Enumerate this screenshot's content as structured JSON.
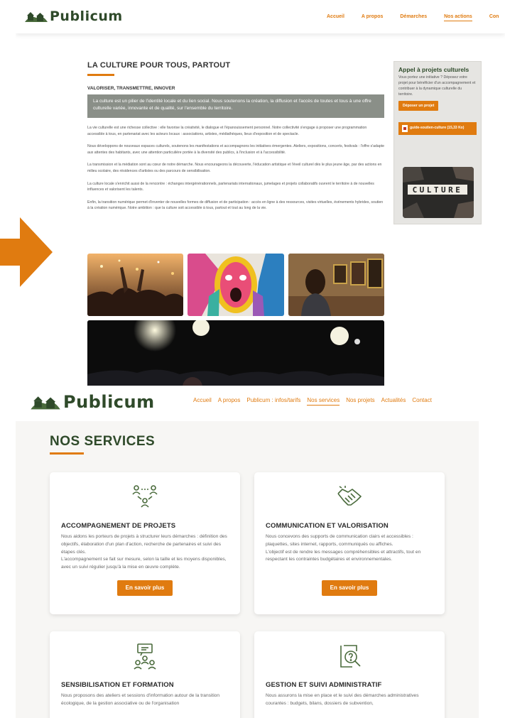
{
  "top_screenshot": {
    "brand": "Publicum",
    "nav": [
      "Accueil",
      "A propos",
      "Démarches",
      "Nos actions",
      "Con"
    ],
    "active_nav_index": 3,
    "page_title": "LA CULTURE POUR TOUS, PARTOUT",
    "subtitle": "VALORISER, TRANSMETTRE, INNOVER",
    "intro": "La culture est un pilier de l'identité locale et du lien social. Nous soutenons la création, la diffusion et l'accès de toutes et tous à une offre culturelle variée, innovante et de qualité, sur l'ensemble du territoire.",
    "paragraphs": [
      "La vie culturelle est une richesse collective : elle favorise la créativité, le dialogue et l'épanouissement personnel. Notre collectivité s'engage à proposer une programmation accessible à tous, en partenariat avec les acteurs locaux : associations, artistes, médiathèques, lieux d'exposition et de spectacle.",
      "Nous développons de nouveaux espaces culturels, soutenons les manifestations et accompagnons les initiatives émergentes. Ateliers, expositions, concerts, festivals : l'offre s'adapte aux attentes des habitants, avec une attention particulière portée à la diversité des publics, à l'inclusion et à l'accessibilité.",
      "La transmission et la médiation sont au cœur de notre démarche. Nous encourageons la découverte, l'éducation artistique et l'éveil culturel dès le plus jeune âge, par des actions en milieu scolaire, des résidences d'artistes ou des parcours de sensibilisation.",
      "La culture locale s'enrichit aussi de la rencontre : échanges intergénérationnels, partenariats internationaux, jumelages et projets collaboratifs ouvrent le territoire à de nouvelles influences et valorisent les talents.",
      "Enfin, la transition numérique permet d'inventer de nouvelles formes de diffusion et de participation : accès en ligne à des ressources, visites virtuelles, événements hybrides, soutien à la création numérique. Notre ambition : que la culture soit accessible à tous, partout et tout au long de la vie."
    ],
    "sidebar": {
      "title": "Appel à projets culturels",
      "text": "Vous portez une initiative ? Déposez votre projet pour bénéficier d'un accompagnement et contribuer à la dynamique culturelle du territoire.",
      "button": "Déposer un projet",
      "file": "guide-soutien-culture (15,33 Ko)",
      "image_word": "CULTURE"
    }
  },
  "bottom_screenshot": {
    "brand": "Publicum",
    "nav": [
      "Accueil",
      "A propos",
      "Publicum : infos/tarifs",
      "Nos services",
      "Nos projets",
      "Actualités",
      "Contact"
    ],
    "active_nav_index": 3,
    "section_title": "NOS SERVICES",
    "cards": [
      {
        "icon": "people-network-icon",
        "title": "ACCOMPAGNEMENT DE PROJETS",
        "text": "Nous aidons les porteurs de projets à structurer leurs démarches : définition des objectifs, élaboration d'un plan d'action, recherche de partenaires et suivi des étapes clés.",
        "text2": "L'accompagnement se fait sur mesure, selon la taille et les moyens disponibles, avec un suivi régulier jusqu'à la mise en œuvre complète.",
        "button": "En savoir plus"
      },
      {
        "icon": "handshake-icon",
        "title": "COMMUNICATION ET VALORISATION",
        "text": "Nous concevons des supports de communication clairs et accessibles : plaquettes, sites internet, rapports, communiqués ou affiches.",
        "text2": "L'objectif est de rendre les messages compréhensibles et attractifs, tout en respectant les contraintes budgétaires et environnementales.",
        "button": "En savoir plus"
      },
      {
        "icon": "training-group-icon",
        "title": "SENSIBILISATION ET FORMATION",
        "text": "Nous proposons des ateliers et sessions d'information autour de la transition écologique, de la gestion associative ou de l'organisation",
        "text2": "",
        "button": ""
      },
      {
        "icon": "document-search-icon",
        "title": "GESTION ET SUIVI ADMINISTRATIF",
        "text": "Nous assurons la mise en place et le suivi des démarches administratives courantes : budgets, bilans, dossiers de subvention,",
        "text2": "",
        "button": ""
      }
    ]
  },
  "colors": {
    "accent": "#e07b10",
    "brand_green": "#2f4a2a",
    "intro_box": "#8a8f88",
    "sidebar_bg": "#e6e5e2"
  }
}
